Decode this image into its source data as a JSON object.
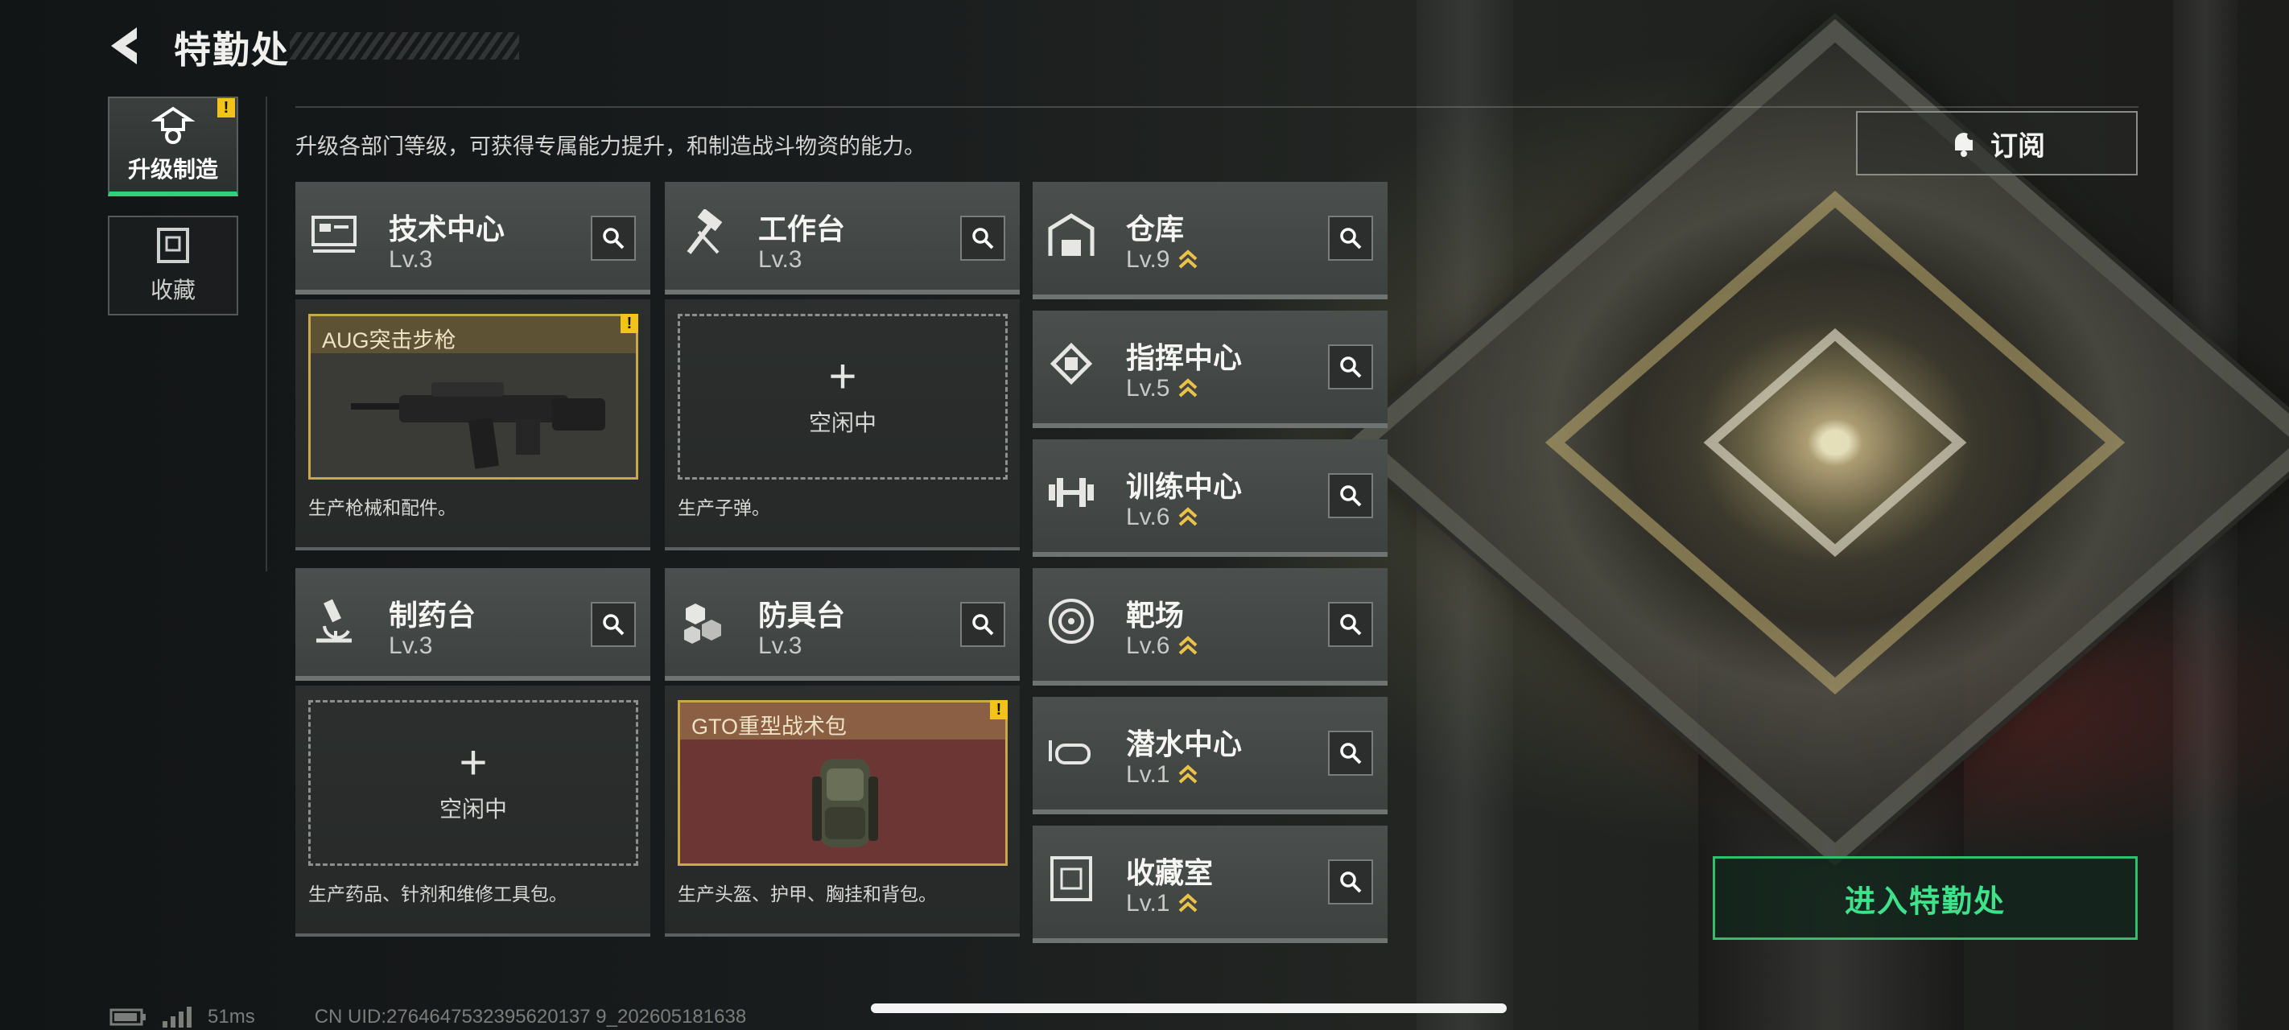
{
  "header": {
    "title": "特勤处"
  },
  "sidenav": [
    {
      "label": "升级制造",
      "active": true,
      "warn": "!"
    },
    {
      "label": "收藏",
      "active": false
    }
  ],
  "description": "升级各部门等级，可获得专属能力提升，和制造战斗物资的能力。",
  "facilities_main": [
    {
      "name": "技术中心",
      "level": "Lv.3",
      "icon": "computer-icon",
      "slot": {
        "state": "item",
        "item_name": "AUG突击步枪",
        "warn": "!"
      },
      "desc": "生产枪械和配件。"
    },
    {
      "name": "工作台",
      "level": "Lv.3",
      "icon": "hammer-icon",
      "slot": {
        "state": "empty",
        "plus": "+",
        "idle_label": "空闲中"
      },
      "desc": "生产子弹。"
    },
    {
      "name": "制药台",
      "level": "Lv.3",
      "icon": "microscope-icon",
      "slot": {
        "state": "empty",
        "plus": "+",
        "idle_label": "空闲中"
      },
      "desc": "生产药品、针剂和维修工具包。"
    },
    {
      "name": "防具台",
      "level": "Lv.3",
      "icon": "cubes-icon",
      "slot": {
        "state": "item",
        "item_name": "GTO重型战术包",
        "warn": "!"
      },
      "desc": "生产头盔、护甲、胸挂和背包。"
    }
  ],
  "facilities_list": [
    {
      "name": "仓库",
      "level": "Lv.9",
      "icon": "warehouse-icon",
      "upgradable": true
    },
    {
      "name": "指挥中心",
      "level": "Lv.5",
      "icon": "chip-icon",
      "upgradable": true
    },
    {
      "name": "训练中心",
      "level": "Lv.6",
      "icon": "dumbbell-icon",
      "upgradable": true
    },
    {
      "name": "靶场",
      "level": "Lv.6",
      "icon": "target-icon",
      "upgradable": true
    },
    {
      "name": "潜水中心",
      "level": "Lv.1",
      "icon": "goggles-icon",
      "upgradable": true
    },
    {
      "name": "收藏室",
      "level": "Lv.1",
      "icon": "trophy-case-icon",
      "upgradable": true
    }
  ],
  "subscribe_label": "订阅",
  "enter_label": "进入特勤处",
  "footer": {
    "ping": "51ms",
    "uid": "CN UID:2764647532395620137 9_202605181638"
  },
  "colors": {
    "accent_green": "#2fbf6d",
    "warn_yellow": "#f2c318",
    "upgrade_gold": "#e9c247"
  }
}
